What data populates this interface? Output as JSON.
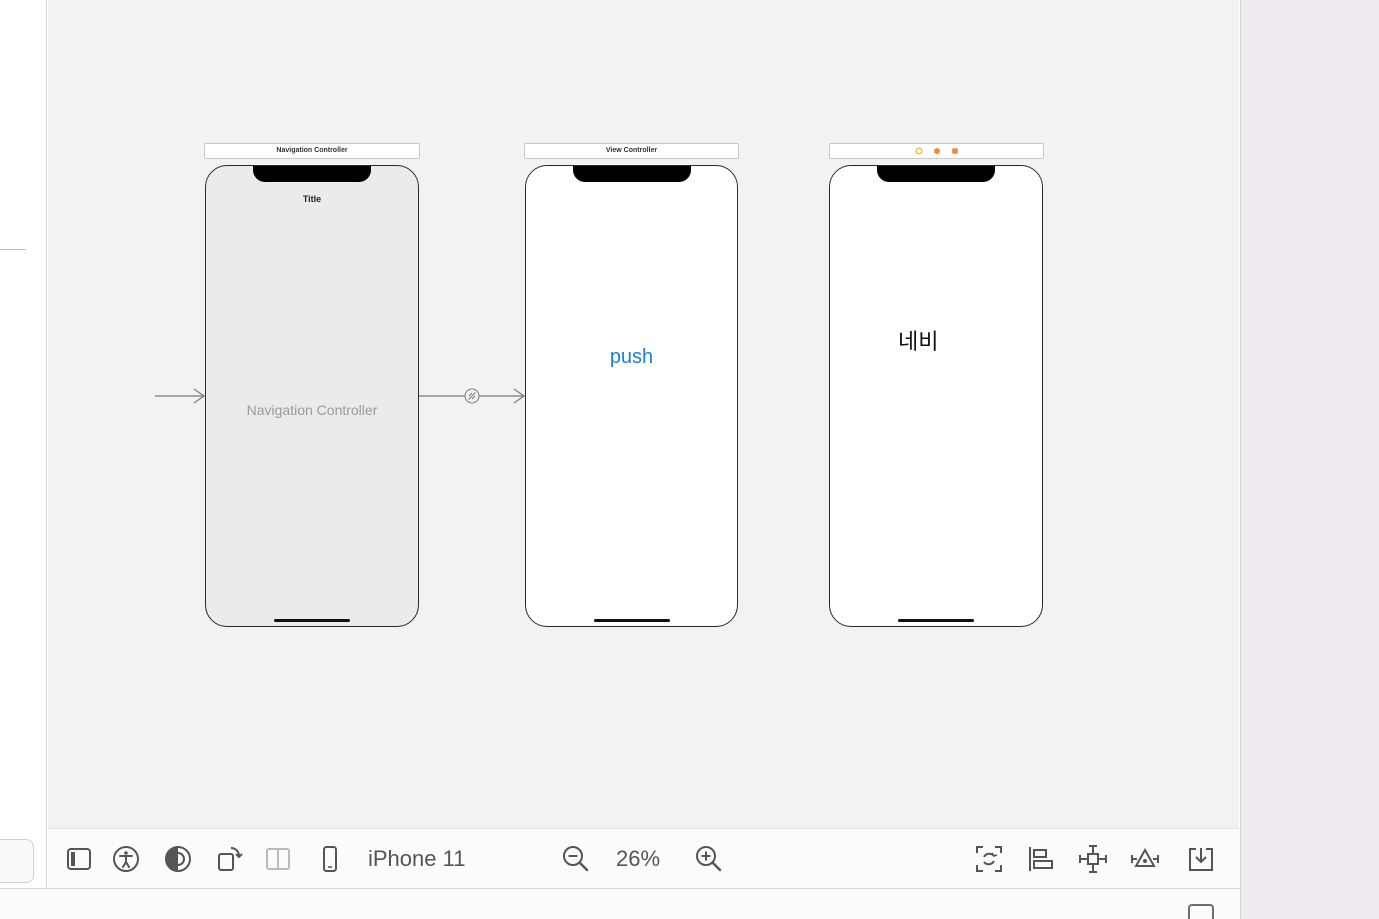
{
  "canvas": {
    "background": "#f2f2f2",
    "scenes": [
      {
        "bar_title": "Navigation Controller",
        "title": "Title",
        "center_label": "Navigation Controller"
      },
      {
        "bar_title": "View Controller",
        "button_label": "push"
      },
      {
        "bar_title": "",
        "label": "네비"
      }
    ]
  },
  "toolbar": {
    "device": "iPhone 11",
    "zoom": "26%",
    "icons": [
      "device-frame-icon",
      "accessibility-icon",
      "appearance-icon",
      "orientation-icon",
      "split-view-icon",
      "iphone-icon",
      "zoom-out-icon",
      "zoom-in-icon",
      "update-frames-icon",
      "align-icon",
      "add-constraints-icon",
      "resolve-issues-icon",
      "embed-in-icon"
    ]
  },
  "colors": {
    "accent": "#1a7fd4",
    "scene_icon_yellow": "#f5b731",
    "scene_icon_orange": "#f08a3c"
  }
}
